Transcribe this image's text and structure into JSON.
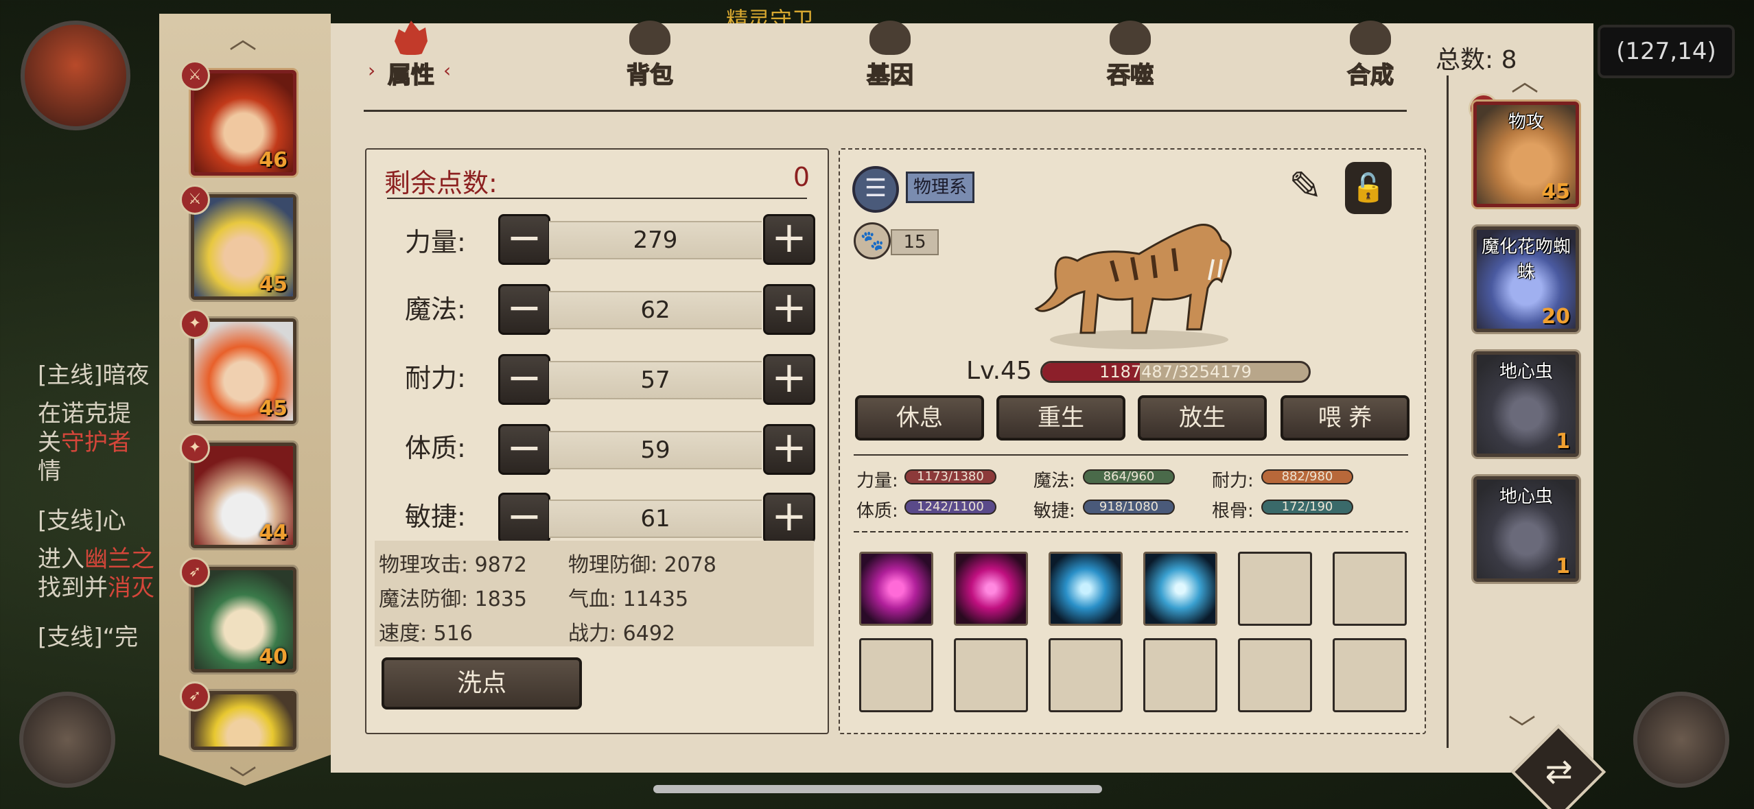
{
  "hud": {
    "coords": "(127,14)",
    "quest_top": "精灵守卫",
    "quests": [
      {
        "tag": "[主线]暗夜",
        "line1": "在诺克提",
        "line2a": "关",
        "line2b": "守护者",
        "line3": "情"
      },
      {
        "tag": "[支线]",
        "tag2": "心",
        "line1a": "进入",
        "line1b": "幽兰之",
        "line2a": "找到并",
        "line2b": "消灭"
      },
      {
        "tag": "[支线]“完"
      }
    ]
  },
  "tabs": [
    {
      "label": "属性",
      "active": true
    },
    {
      "label": "背包"
    },
    {
      "label": "基因"
    },
    {
      "label": "吞噬"
    },
    {
      "label": "合成"
    }
  ],
  "attributes": {
    "remaining_label": "剩余点数:",
    "remaining_value": "0",
    "rows": [
      {
        "label": "力量:",
        "value": "279"
      },
      {
        "label": "魔法:",
        "value": "62"
      },
      {
        "label": "耐力:",
        "value": "57"
      },
      {
        "label": "体质:",
        "value": "59"
      },
      {
        "label": "敏捷:",
        "value": "61"
      }
    ],
    "minus": "−",
    "plus": "+",
    "stats": [
      {
        "label": "物理攻击:",
        "value": "9872"
      },
      {
        "label": "物理防御:",
        "value": "2078"
      },
      {
        "label": "魔法防御:",
        "value": "1835"
      },
      {
        "label": "气血:",
        "value": "11435"
      },
      {
        "label": "速度:",
        "value": "516"
      },
      {
        "label": "战力:",
        "value": "6492"
      }
    ],
    "wash_label": "洗点"
  },
  "pet": {
    "type_label": "物理系",
    "food": "15",
    "level": "Lv.45",
    "exp": "1187487/3254179",
    "exp_fraction": 0.365,
    "actions": [
      "休息",
      "重生",
      "放生",
      "喂 养"
    ],
    "growth": [
      {
        "label": "力量:",
        "value": "1173/1380",
        "color": "#8c3a3a"
      },
      {
        "label": "魔法:",
        "value": "864/960",
        "color": "#4a6a4a"
      },
      {
        "label": "耐力:",
        "value": "882/980",
        "color": "#b8683a"
      },
      {
        "label": "体质:",
        "value": "1242/1100",
        "color": "#5a4a8a"
      },
      {
        "label": "敏捷:",
        "value": "918/1080",
        "color": "#4a5a7a"
      },
      {
        "label": "根骨:",
        "value": "172/190",
        "color": "#3a6a6a"
      }
    ],
    "skills": [
      "skull-skill-icon",
      "pink-slash-skill-icon",
      "ice-claw-skill-icon",
      "vortex-skill-icon"
    ]
  },
  "roster": {
    "total": "总数: 8",
    "pets": [
      {
        "name": "物攻",
        "level": "45"
      },
      {
        "name": "魔化花吻蜘蛛",
        "level": "20"
      },
      {
        "name": "地心虫",
        "level": "1"
      },
      {
        "name": "地心虫",
        "level": "1"
      }
    ]
  },
  "heroes": [
    {
      "level": "46"
    },
    {
      "level": "45"
    },
    {
      "level": "45"
    },
    {
      "level": "44"
    },
    {
      "level": "40"
    },
    {
      "level": ""
    }
  ]
}
